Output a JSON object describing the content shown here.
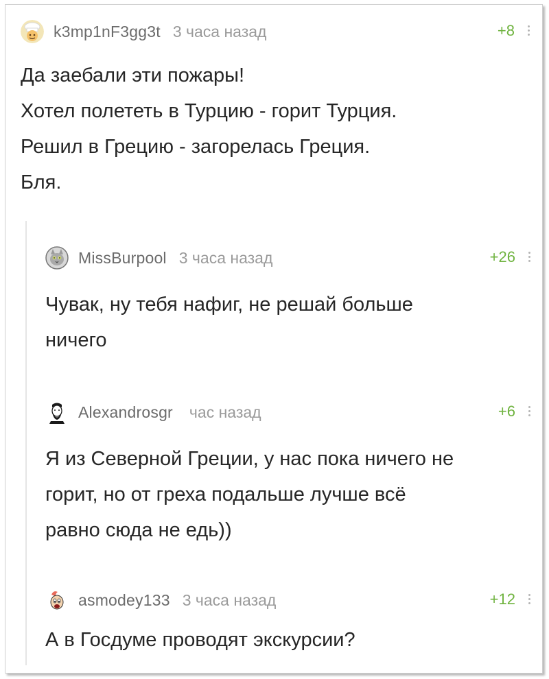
{
  "comments": [
    {
      "username": "k3mp1nF3gg3t",
      "time": "3 часа назад",
      "rating": "+8",
      "avatar": "chef-avatar-icon",
      "lines": [
        "Да заебали эти пожары!",
        "Хотел полететь в Турцию - горит Турция.",
        "Решил в Грецию - загорелась Греция.",
        "Бля."
      ]
    },
    {
      "username": "MissBurpool",
      "time": "3 часа назад",
      "rating": "+26",
      "avatar": "cat-avatar-icon",
      "lines": [
        "Чувак, ну тебя нафиг, не решай больше",
        "ничего"
      ]
    },
    {
      "username": "Alexandrosgr",
      "time": "час назад",
      "rating": "+6",
      "avatar": "bearded-man-avatar-icon",
      "lines": [
        "Я из Северной Греции, у нас пока ничего не",
        "горит, но от греха подальше лучше всё",
        "равно сюда не едь))"
      ]
    },
    {
      "username": "asmodey133",
      "time": "3 часа назад",
      "rating": "+12",
      "avatar": "cartoon-avatar-icon",
      "lines": [
        "А в Госдуме проводят экскурсии?"
      ]
    }
  ],
  "colors": {
    "username": "#6b6b6b",
    "time": "#9a9a9a",
    "rating": "#6fb33f",
    "text": "#262626",
    "thread_line": "#e5e5e5"
  }
}
